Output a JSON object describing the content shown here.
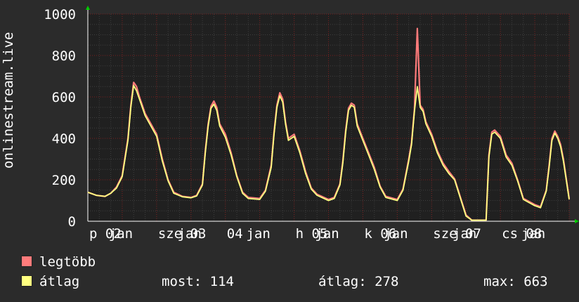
{
  "chart_data": {
    "type": "line",
    "ylabel": "onlinestream.live",
    "ylim": [
      0,
      1000
    ],
    "yticks": [
      0,
      200,
      400,
      600,
      800,
      1000
    ],
    "xticklabels": [
      "p 02",
      "jan",
      "sze 03",
      "jan",
      "04",
      "jan",
      "h 05",
      "jan",
      "k 06",
      "jan",
      "sze 07",
      "jan",
      "cs 08",
      "jan"
    ],
    "grid": true,
    "xlim": [
      0,
      168
    ],
    "series": [
      {
        "name": "legtöbb",
        "color": "#ff7b7b",
        "x": [
          0,
          3,
          6,
          8,
          10,
          12,
          14,
          15,
          16,
          17,
          18,
          19,
          20,
          22,
          24,
          26,
          28,
          30,
          33,
          36,
          38,
          40,
          41,
          42,
          43,
          44,
          45,
          46,
          48,
          50,
          52,
          54,
          56,
          60,
          62,
          64,
          65,
          66,
          67,
          68,
          69,
          70,
          72,
          74,
          76,
          78,
          80,
          84,
          86,
          88,
          89,
          90,
          91,
          92,
          93,
          94,
          96,
          98,
          100,
          102,
          104,
          108,
          110,
          112,
          113,
          114,
          115,
          116,
          117,
          118,
          120,
          122,
          124,
          126,
          128,
          132,
          134,
          136,
          137,
          138,
          139,
          140,
          141,
          142,
          144,
          146,
          148,
          150,
          152,
          156,
          158,
          160,
          161,
          162,
          163,
          164,
          165,
          166,
          168
        ],
        "values": [
          140,
          125,
          120,
          135,
          165,
          220,
          400,
          560,
          670,
          650,
          600,
          560,
          520,
          470,
          420,
          300,
          200,
          140,
          120,
          115,
          125,
          180,
          340,
          470,
          555,
          580,
          550,
          470,
          420,
          330,
          220,
          140,
          115,
          110,
          150,
          270,
          430,
          560,
          620,
          590,
          480,
          400,
          420,
          340,
          240,
          160,
          130,
          105,
          115,
          180,
          290,
          440,
          545,
          570,
          560,
          470,
          400,
          330,
          260,
          170,
          120,
          105,
          155,
          300,
          380,
          540,
          930,
          560,
          540,
          480,
          420,
          340,
          280,
          240,
          205,
          30,
          5,
          5,
          5,
          5,
          5,
          320,
          430,
          440,
          410,
          320,
          280,
          200,
          110,
          80,
          70,
          150,
          270,
          400,
          435,
          410,
          370,
          300,
          110
        ]
      },
      {
        "name": "átlag",
        "color": "#ffff80",
        "x": [
          0,
          3,
          6,
          8,
          10,
          12,
          14,
          15,
          16,
          17,
          18,
          19,
          20,
          22,
          24,
          26,
          28,
          30,
          33,
          36,
          38,
          40,
          41,
          42,
          43,
          44,
          45,
          46,
          48,
          50,
          52,
          54,
          56,
          60,
          62,
          64,
          65,
          66,
          67,
          68,
          69,
          70,
          72,
          74,
          76,
          78,
          80,
          84,
          86,
          88,
          89,
          90,
          91,
          92,
          93,
          94,
          96,
          98,
          100,
          102,
          104,
          108,
          110,
          112,
          113,
          114,
          115,
          116,
          117,
          118,
          120,
          122,
          124,
          126,
          128,
          132,
          134,
          136,
          137,
          138,
          139,
          140,
          141,
          142,
          144,
          146,
          148,
          150,
          152,
          156,
          158,
          160,
          161,
          162,
          163,
          164,
          165,
          166,
          168
        ],
        "values": [
          140,
          125,
          120,
          135,
          160,
          215,
          390,
          550,
          655,
          630,
          590,
          550,
          510,
          460,
          410,
          290,
          195,
          135,
          118,
          113,
          122,
          175,
          330,
          460,
          545,
          565,
          535,
          460,
          405,
          320,
          215,
          135,
          110,
          105,
          145,
          260,
          420,
          550,
          605,
          575,
          470,
          390,
          410,
          330,
          230,
          155,
          125,
          100,
          110,
          175,
          280,
          430,
          535,
          560,
          550,
          460,
          390,
          320,
          250,
          165,
          115,
          100,
          150,
          290,
          370,
          530,
          650,
          550,
          530,
          470,
          410,
          330,
          270,
          230,
          200,
          25,
          5,
          5,
          5,
          5,
          5,
          310,
          420,
          430,
          400,
          310,
          270,
          195,
          105,
          75,
          65,
          145,
          260,
          390,
          425,
          400,
          360,
          290,
          105
        ]
      }
    ],
    "stats": {
      "now_label": "most:",
      "now": "114",
      "avg_label": "átlag:",
      "avg": "278",
      "max_label": "max:",
      "max": "663"
    }
  },
  "colors": {
    "background": "#2b2b2b",
    "plot_bg": "#202020",
    "axis": "#ffffff",
    "grid_minor": "#3e3e3e",
    "grid_major": "#7a1e1e",
    "arrow": "#00cc00"
  }
}
